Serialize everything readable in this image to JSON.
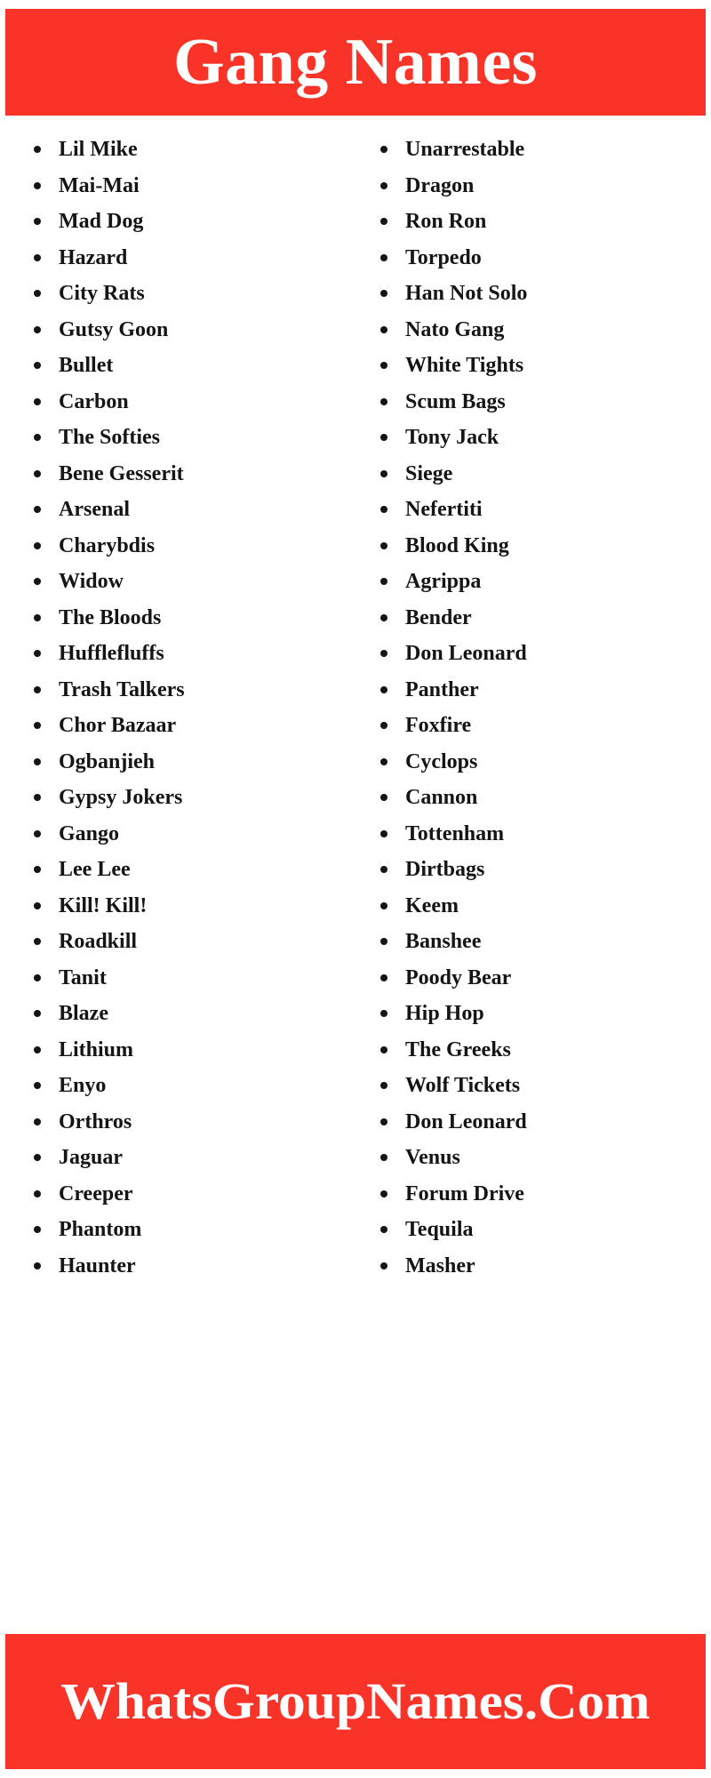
{
  "header": {
    "title": "Gang Names",
    "background_color": "#fa3329",
    "text_color": "#ffffff"
  },
  "footer": {
    "text": "WhatsGroupNames.Com",
    "background_color": "#fa3329",
    "text_color": "#ffffff"
  },
  "body": {
    "background_color": "#ffffff",
    "text_color": "#151515",
    "bullet_color": "#151515",
    "columns": [
      {
        "id": "left",
        "items": [
          "Lil Mike",
          "Mai-Mai",
          "Mad Dog",
          "Hazard",
          "City Rats",
          "Gutsy Goon",
          "Bullet",
          "Carbon",
          "The Softies",
          "Bene Gesserit",
          "Arsenal",
          "Charybdis",
          "Widow",
          "The Bloods",
          "Hufflefluffs",
          "Trash Talkers",
          "Chor Bazaar",
          "Ogbanjieh",
          "Gypsy Jokers",
          "Gango",
          "Lee Lee",
          "Kill! Kill!",
          "Roadkill",
          "Tanit",
          "Blaze",
          "Lithium",
          "Enyo",
          "Orthros",
          "Jaguar",
          "Creeper",
          "Phantom",
          "Haunter"
        ]
      },
      {
        "id": "right",
        "items": [
          "Unarrestable",
          "Dragon",
          "Ron Ron",
          "Torpedo",
          "Han Not Solo",
          "Nato Gang",
          "White Tights",
          "Scum Bags",
          "Tony Jack",
          "Siege",
          "Nefertiti",
          "Blood King",
          "Agrippa",
          "Bender",
          "Don Leonard",
          "Panther",
          "Foxfire",
          "Cyclops",
          "Cannon",
          "Tottenham",
          "Dirtbags",
          "Keem",
          "Banshee",
          "Poody Bear",
          "Hip Hop",
          "The Greeks",
          "Wolf Tickets",
          "Don Leonard",
          "Venus",
          "Forum Drive",
          "Tequila",
          "Masher"
        ]
      }
    ]
  }
}
